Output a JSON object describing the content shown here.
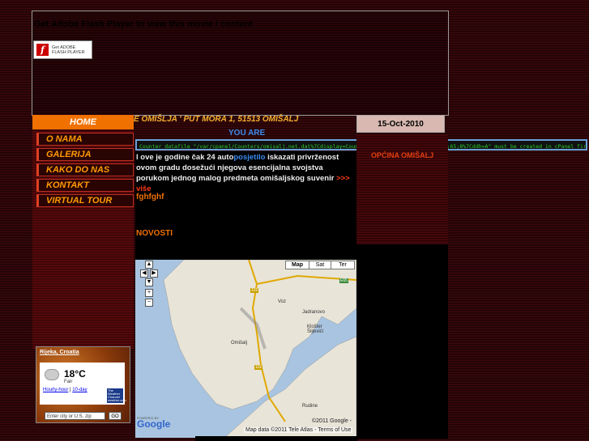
{
  "flash": {
    "message": "Get Adobe Flash Player to view this movie / content",
    "badge_line1": "Get ADOBE",
    "badge_line2": "FLASH PLAYER",
    "badge_logo": "f"
  },
  "nav": {
    "home": "HOME",
    "items": [
      {
        "label": "O NAMA"
      },
      {
        "label": "GALERIJA"
      },
      {
        "label": "KAKO DO NAS"
      },
      {
        "label": "KONTAKT"
      },
      {
        "label": "VIRTUAL TOUR"
      }
    ]
  },
  "address": "E OMIŠLJA ' PUT MORA 1, 51513 OMIŠALJ",
  "you_are": "YOU ARE",
  "counter_text": "Counter datafile \"/var/cpanel/Counters/omisalj.net.dat%7Cdisplay=Counter%7Cft=6%7Cmd=5%7Cfrgb=131;65;8%7Cddh=A\" must be created in cPanel first!",
  "intro": {
    "text_before": "l ove je godine čak 24 auto",
    "overlay": "posjetilo",
    "text_after": " iskazati privrženost ovom gradu dosežući njegova esencijalna svojstva porukom jednog malog predmeta omišaljskog suvenir ",
    "more": ">>> više"
  },
  "fghf": "fghfghf",
  "novosti": "NOVOSTI",
  "date": "15-Oct-2010",
  "opcina": "OPĆINA OMIŠALJ",
  "weather": {
    "city": "Rijeka, Croatia",
    "temp": "18°C",
    "condition": "Fair",
    "link_hourly": "Hourly-hour",
    "link_sep": " | ",
    "link_10day": "10-day",
    "logo": "The Weather Channel weather.com",
    "input_placeholder": "Enter city or U.S. zip",
    "go": "GO"
  },
  "map": {
    "btn_map": "Map",
    "btn_sat": "Sat",
    "btn_ter": "Ter",
    "places": [
      "Voz",
      "Jadranovo",
      "Klošter Šiljevići",
      "Omišalj",
      "Rudine",
      "Kraj",
      "Dramalj"
    ],
    "roads": [
      "102",
      "102",
      "E65"
    ],
    "powered": "POWERED BY",
    "google": "Google",
    "copyright_google": "©2011 Google -",
    "copyright": "Map data ©2011 Tele Atlas - Terms of Use"
  }
}
